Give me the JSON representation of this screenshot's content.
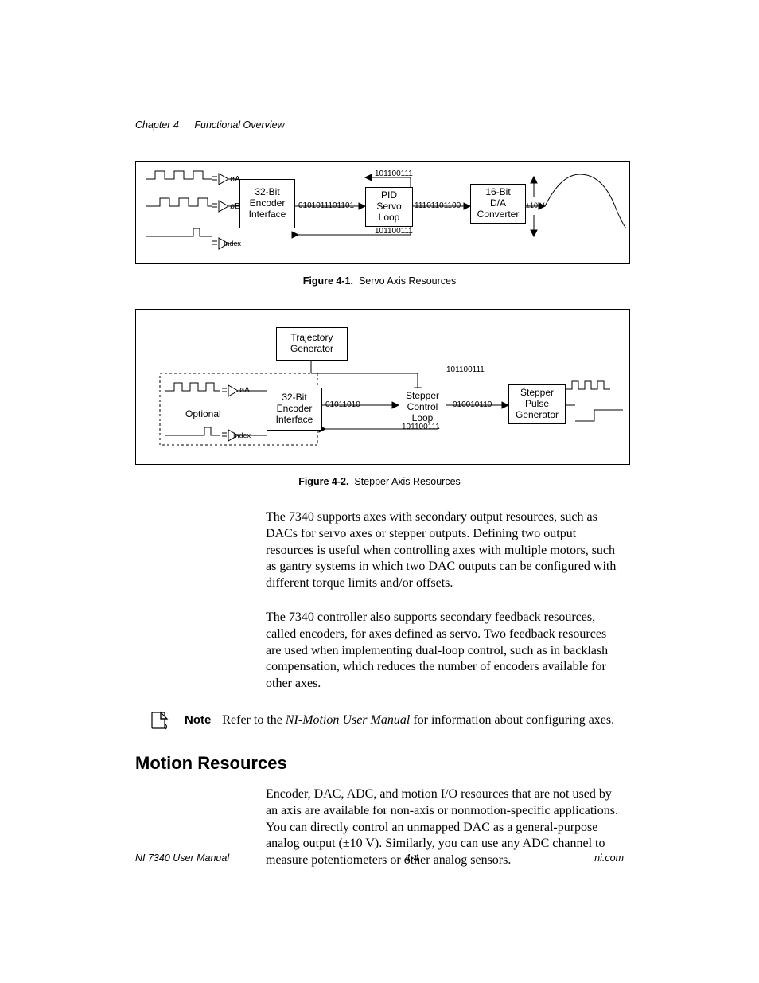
{
  "header": {
    "chapter": "Chapter 4",
    "title": "Functional Overview"
  },
  "figure1": {
    "caption_no": "Figure 4-1.",
    "caption_text": "Servo Axis Resources",
    "labels": {
      "phiA": "øA",
      "phiB": "øB",
      "index": "Index",
      "encoder": "32-Bit\nEncoder\nInterface",
      "servo_block": "PID\nServo\nLoop",
      "da_block": "16-Bit\nD/A\nConverter",
      "bits_top": "101100111",
      "bits_mid_left": "0101011101101",
      "bits_mid_right": "11101101100",
      "bits_bot": "101100111",
      "pm10v": "±10 V"
    }
  },
  "figure2": {
    "caption_no": "Figure 4-2.",
    "caption_text": "Stepper Axis Resources",
    "labels": {
      "traj": "Trajectory\nGenerator",
      "optional": "Optional",
      "phiA": "øA",
      "index": "Index",
      "encoder": "32-Bit\nEncoder\nInterface",
      "stepper_ctrl": "Stepper\nControl\nLoop",
      "stepper_pulse": "Stepper\nPulse\nGenerator",
      "bits_top": "101100111",
      "bits_left": "01011010",
      "bits_mid": "010010110",
      "bits_bot": "101100111"
    }
  },
  "para1": "The 7340 supports axes with secondary output resources, such as DACs for servo axes or stepper outputs. Defining two output resources is useful when controlling axes with multiple motors, such as gantry systems in which two DAC outputs can be configured with different torque limits and/or offsets.",
  "para2": "The 7340 controller also supports secondary feedback resources, called encoders, for axes defined as servo. Two feedback resources are used when implementing dual-loop control, such as in backlash compensation, which reduces the number of encoders available for other axes.",
  "note": {
    "label": "Note",
    "text_before_italic": "Refer to the ",
    "italic": "NI-Motion User Manual",
    "text_after_italic": " for information about configuring axes."
  },
  "section_heading": "Motion Resources",
  "para3": "Encoder, DAC, ADC, and motion I/O resources that are not used by an axis are available for non-axis or nonmotion-specific applications. You can directly control an unmapped DAC as a general-purpose analog output (±10 V). Similarly, you can use any ADC channel to measure potentiometers or other analog sensors.",
  "footer": {
    "left": "NI 7340 User Manual",
    "center": "4-4",
    "right": "ni.com"
  }
}
